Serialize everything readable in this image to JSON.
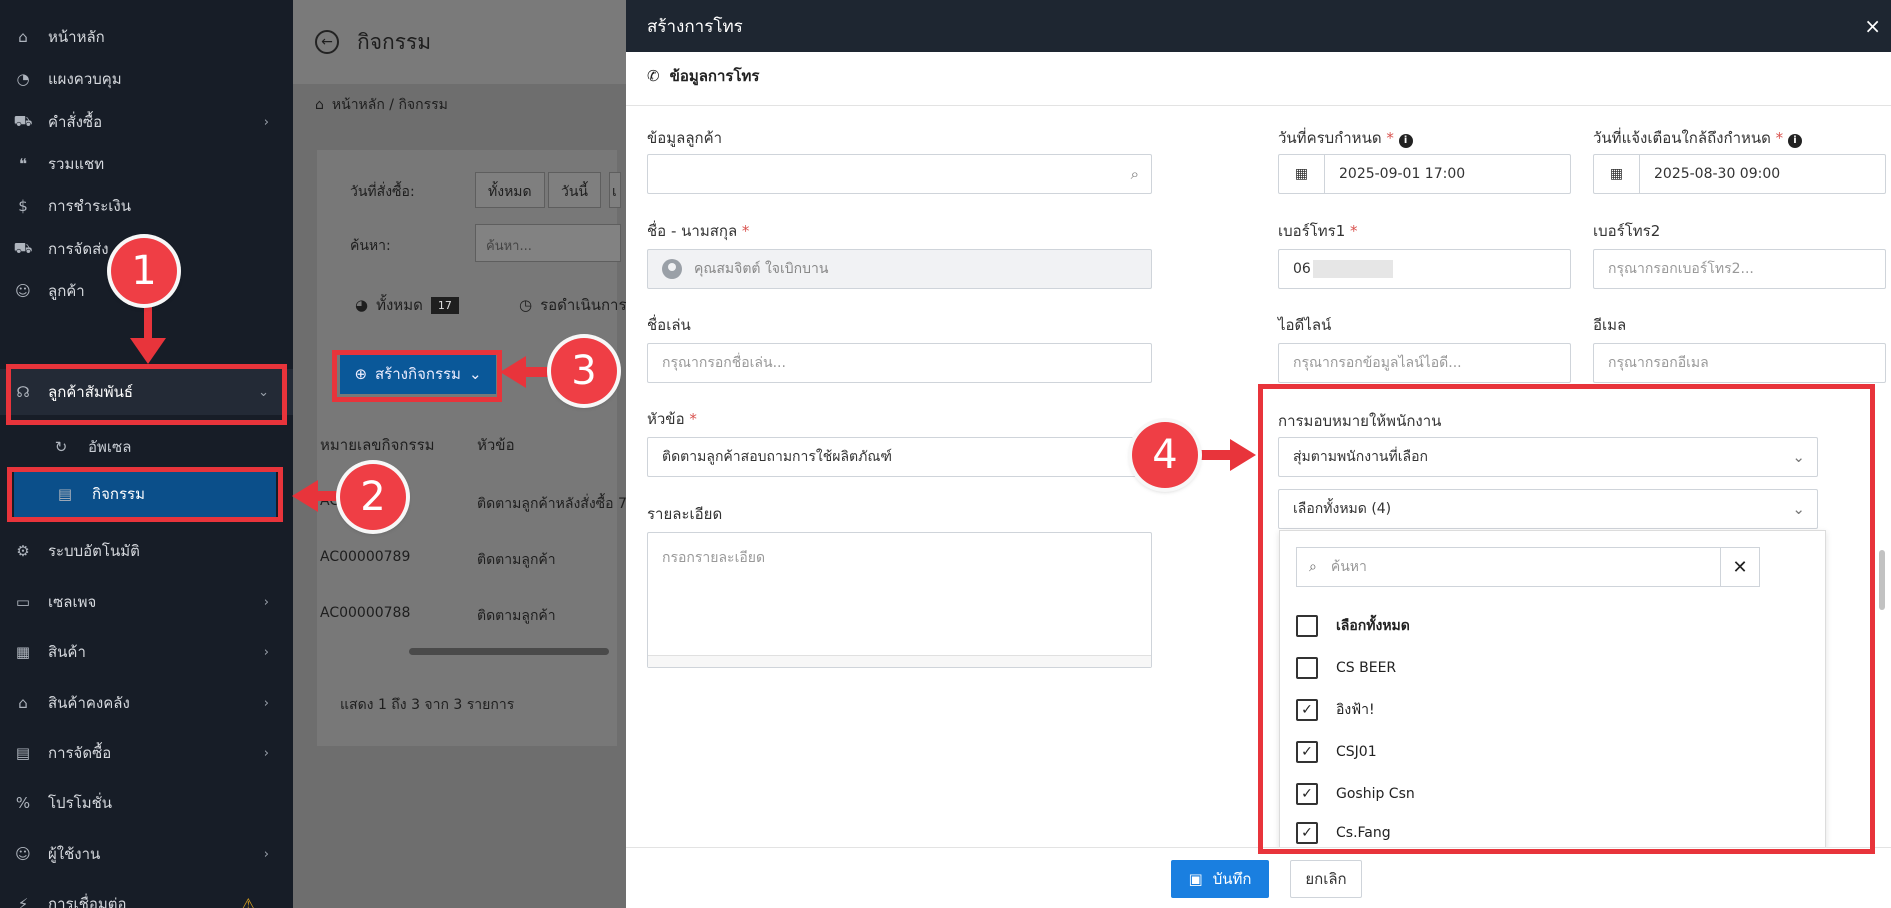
{
  "sidebar": {
    "items": [
      {
        "label": "หน้าหลัก",
        "icon": "home-icon",
        "glyph": "⌂",
        "chevron": false
      },
      {
        "label": "แผงควบคุม",
        "icon": "dashboard-icon",
        "glyph": "◔",
        "chevron": false
      },
      {
        "label": "คำสั่งซื้อ",
        "icon": "cart-icon",
        "glyph": "🛒",
        "chevron": true
      },
      {
        "label": "รวมแชท",
        "icon": "chat-icon",
        "glyph": "💬",
        "chevron": false
      },
      {
        "label": "การชำระเงิน",
        "icon": "money-bag-icon",
        "glyph": "$",
        "chevron": false
      },
      {
        "label": "การจัดส่ง",
        "icon": "truck-icon",
        "glyph": "🚚",
        "chevron": false
      },
      {
        "label": "ลูกค้า",
        "icon": "users-icon",
        "glyph": "👥",
        "chevron": false
      },
      {
        "label": "ลูกค้าสัมพันธ์",
        "icon": "headset-icon",
        "glyph": "🎧",
        "chevron": true,
        "active": true
      },
      {
        "label": "ระบบอัตโนมัติ",
        "icon": "robot-icon",
        "glyph": "⚙",
        "chevron": false
      },
      {
        "label": "เซลเพจ",
        "icon": "browser-icon",
        "glyph": "▭",
        "chevron": true
      },
      {
        "label": "สินค้า",
        "icon": "boxes-icon",
        "glyph": "▦",
        "chevron": true
      },
      {
        "label": "สินค้าคงคลัง",
        "icon": "warehouse-icon",
        "glyph": "🏭",
        "chevron": true
      },
      {
        "label": "การจัดซื้อ",
        "icon": "dolly-icon",
        "glyph": "▤",
        "chevron": true
      },
      {
        "label": "โปรโมชั่น",
        "icon": "percent-icon",
        "glyph": "%",
        "chevron": false
      },
      {
        "label": "ผู้ใช้งาน",
        "icon": "user-group-icon",
        "glyph": "👤",
        "chevron": true
      },
      {
        "label": "การเชื่อมต่อ",
        "icon": "plug-icon",
        "glyph": "⚡",
        "chevron": false,
        "warning": true
      }
    ],
    "sub_items": [
      {
        "label": "อัพเซล",
        "icon": "refresh-icon",
        "glyph": "↻"
      },
      {
        "label": "กิจกรรม",
        "icon": "list-icon",
        "glyph": "▤",
        "selected": true
      }
    ]
  },
  "background_page": {
    "title": "กิจกรรม",
    "breadcrumb": "หน้าหลัก / กิจกรรม",
    "order_date_label": "วันที่สั่งซื้อ:",
    "date_pills": [
      "ทั้งหมด",
      "วันนี้",
      "เ"
    ],
    "search_label": "ค้นหา:",
    "search_placeholder": "ค้นหา...",
    "tabs": [
      {
        "label": "ทั้งหมด",
        "count": "17"
      },
      {
        "label": "รอดำเนินการ",
        "count": ""
      }
    ],
    "create_button": "สร้างกิจกรรม",
    "columns": [
      "หมายเลขกิจกรรม",
      "หัวข้อ"
    ],
    "rows": [
      {
        "id": "AC",
        "subject": "ติดตามลูกค้าหลังสั่งซื้อ 7"
      },
      {
        "id": "AC00000789",
        "subject": "ติดตามลูกค้า"
      },
      {
        "id": "AC00000788",
        "subject": "ติดตามลูกค้า"
      }
    ],
    "footer": "แสดง 1 ถึง 3 จาก 3 รายการ"
  },
  "modal": {
    "title": "สร้างการโทร",
    "close_glyph": "×",
    "section_title": "ข้อมูลการโทร",
    "fields": {
      "customer_info_label": "ข้อมูลลูกค้า",
      "customer_info_value": "",
      "due_date_label": "วันที่ครบกำหนด",
      "due_date_value": "2025-09-01 17:00",
      "reminder_label": "วันที่แจ้งเตือนใกล้ถึงกำหนด",
      "reminder_value": "2025-08-30 09:00",
      "name_label": "ชื่อ - นามสกุล",
      "name_value": "คุณสมจิตต์ ใจเบิกบาน",
      "phone1_label": "เบอร์โทร1",
      "phone1_value": "06",
      "phone2_label": "เบอร์โทร2",
      "phone2_placeholder": "กรุณากรอกเบอร์โทร2...",
      "nickname_label": "ชื่อเล่น",
      "nickname_placeholder": "กรุณากรอกชื่อเล่น...",
      "line_label": "ไอดีไลน์",
      "line_placeholder": "กรุณากรอกข้อมูลไลน์ไอดี...",
      "email_label": "อีเมล",
      "email_placeholder": "กรุณากรอกอีเมล",
      "subject_label": "หัวข้อ",
      "subject_value": "ติดตามลูกค้าสอบถามการใช้ผลิตภัณฑ์",
      "detail_label": "รายละเอียด",
      "detail_placeholder": "กรอกรายละเอียด",
      "assign_label": "การมอบหมายให้พนักงาน",
      "assign_value": "สุ่มตามพนักงานที่เลือก",
      "staff_select_value": "เลือกทั้งหมด (4)"
    },
    "required_mark": "*",
    "info_glyph": "i",
    "dropdown": {
      "search_placeholder": "ค้นหา",
      "options": [
        {
          "label": "เลือกทั้งหมด",
          "checked": false,
          "bold": true
        },
        {
          "label": "CS BEER",
          "checked": false
        },
        {
          "label": "อิงฟ้า!",
          "checked": true
        },
        {
          "label": "CSJ01",
          "checked": true
        },
        {
          "label": "Goship Csn",
          "checked": true
        },
        {
          "label": "Cs.Fang",
          "checked": true
        }
      ]
    },
    "save_button": "บันทึก",
    "cancel_button": "ยกเลิก"
  },
  "callouts": [
    "1",
    "2",
    "3",
    "4"
  ],
  "colors": {
    "sidebar_bg": "#171d27",
    "modal_header_bg": "#1e2631",
    "primary": "#1a7fe0",
    "callout_red": "#e8343b",
    "required_red": "#d9534f"
  }
}
